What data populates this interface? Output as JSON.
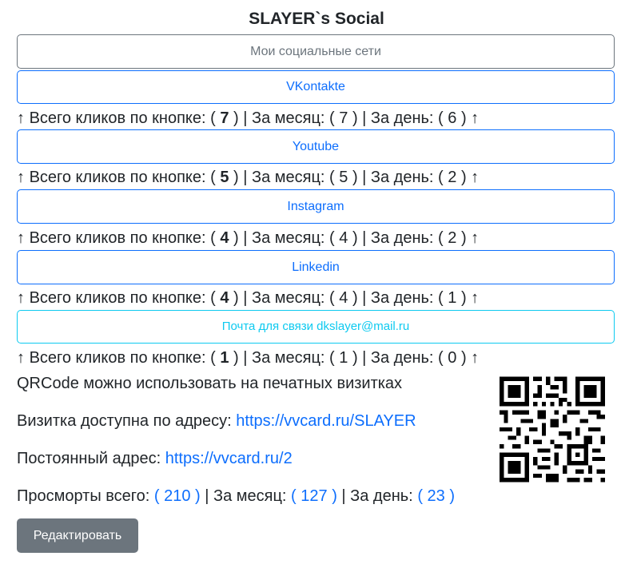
{
  "page": {
    "title": "SLAYER`s Social",
    "header_button": "Мои социальные сети"
  },
  "links": [
    {
      "label": "VKontakte",
      "total": "7",
      "month": "7",
      "day": "6"
    },
    {
      "label": "Youtube",
      "total": "5",
      "month": "5",
      "day": "2"
    },
    {
      "label": "Instagram",
      "total": "4",
      "month": "4",
      "day": "2"
    },
    {
      "label": "Linkedin",
      "total": "4",
      "month": "4",
      "day": "1"
    },
    {
      "label": "Почта для связи dkslayer@mail.ru",
      "total": "1",
      "month": "1",
      "day": "0"
    }
  ],
  "stats_text": {
    "arrow": "↑",
    "total_prefix": "Всего кликов по кнопке: (",
    "month_prefix": ") | За месяц: (",
    "day_prefix": ") | За день: (",
    "suffix": ")"
  },
  "info": {
    "qr_note": "QRCode можно использовать на печатных визитках",
    "card_label": "Визитка доступна по адресу: ",
    "card_url": "https://vvcard.ru/SLAYER",
    "permanent_label": "Постоянный адрес: ",
    "permanent_url": "https://vvcard.ru/2",
    "views_label": "Просморты всего: ",
    "views_total": "( 210 )",
    "views_month_label": " | За месяц: ",
    "views_month": "( 127 )",
    "views_day_label": " | За день: ",
    "views_day": "( 23 )"
  },
  "edit_button": "Редактировать",
  "colors": {
    "primary": "#0d6efd",
    "info": "#0dcaf0",
    "secondary": "#6c757d"
  }
}
